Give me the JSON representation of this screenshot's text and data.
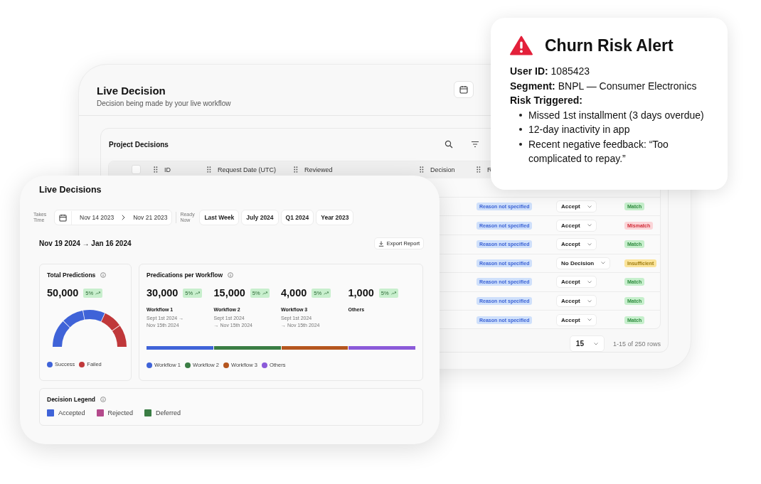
{
  "back_window": {
    "title": "Live Decision",
    "subtitle": "Decision being made by your live workflow",
    "table_card": {
      "title": "Project Decisions",
      "header_checkbox": {
        "checked": false
      },
      "columns": [
        "ID",
        "Request Date (UTC)",
        "Reviewed",
        "Decision",
        "R"
      ],
      "rows": [
        {
          "reason": "Reason not specified",
          "decision": "Accept",
          "status": "Match",
          "kind": "match"
        },
        {
          "reason": "Reason not specified",
          "decision": "Accept",
          "status": "Mismatch",
          "kind": "mismatch"
        },
        {
          "reason": "Reason not specified",
          "decision": "Accept",
          "status": "Match",
          "kind": "match"
        },
        {
          "reason": "Reason not specified",
          "decision": "No Decision",
          "status": "Insufficient",
          "kind": "insufficient"
        },
        {
          "reason": "Reason not specified",
          "decision": "Accept",
          "status": "Match",
          "kind": "match"
        },
        {
          "reason": "Reason not specified",
          "decision": "Accept",
          "status": "Match",
          "kind": "match"
        },
        {
          "reason": "Reason not specified",
          "decision": "Accept",
          "status": "Match",
          "kind": "match"
        }
      ],
      "page_size": "15",
      "range": "1-15 of 250 rows"
    }
  },
  "front_window": {
    "title": "Live Decisions",
    "date_label": "Takes Time",
    "date_from": "Nov 14 2023",
    "date_to": "Nov 21 2023",
    "preset_label": "Ready Now",
    "presets": [
      "Last Week",
      "July 2024",
      "Q1 2024",
      "Year 2023"
    ],
    "range_heading": "Nov 19 2024 → Jan 16 2024",
    "export": "Export Report",
    "total": {
      "title": "Total Predictions",
      "value": "50,000",
      "badge": "5%",
      "legend": [
        {
          "label": "Success",
          "color": "#3f63d8"
        },
        {
          "label": "Failed",
          "color": "#c0383a"
        }
      ]
    },
    "per_workflow": {
      "title": "Predications per Workflow",
      "items": [
        {
          "value": "30,000",
          "badge": "5%",
          "name": "Workflow 1",
          "date_lines": [
            "Sept 1st 2024 →",
            "Nov 15th 2024"
          ]
        },
        {
          "value": "15,000",
          "badge": "5%",
          "name": "Workflow 2",
          "date_lines": [
            "Sept 1st 2024",
            "→ Nov 15th 2024"
          ]
        },
        {
          "value": "4,000",
          "badge": "5%",
          "name": "Workflow 3",
          "date_lines": [
            "Sept 1st 2024",
            "→ Nov 15th 2024"
          ]
        },
        {
          "value": "1,000",
          "badge": "5%",
          "name": "Others"
        }
      ],
      "legend": [
        {
          "label": "Workflow 1",
          "color": "#3f63d8"
        },
        {
          "label": "Workflow 2",
          "color": "#3a7d44"
        },
        {
          "label": "Workflow 3",
          "color": "#b5561f"
        },
        {
          "label": "Others",
          "color": "#8b5ad9"
        }
      ]
    },
    "decision_legend": {
      "title": "Decision Legend",
      "items": [
        {
          "label": "Accepted",
          "color": "#3f63d8"
        },
        {
          "label": "Rejected",
          "color": "#b44a8c"
        },
        {
          "label": "Deferred",
          "color": "#3a7d44"
        }
      ]
    }
  },
  "alert": {
    "title": "Churn Risk Alert",
    "lines": [
      "**User ID:** 1085423",
      "**Segment:** BNPL — Consumer Electronics"
    ],
    "risk_label": "Risk Triggered:",
    "bullets": [
      "Missed 1st installment (3 days overdue)",
      "12-day inactivity in app",
      "Recent negative feedback: “Too complicated to repay.”"
    ]
  }
}
